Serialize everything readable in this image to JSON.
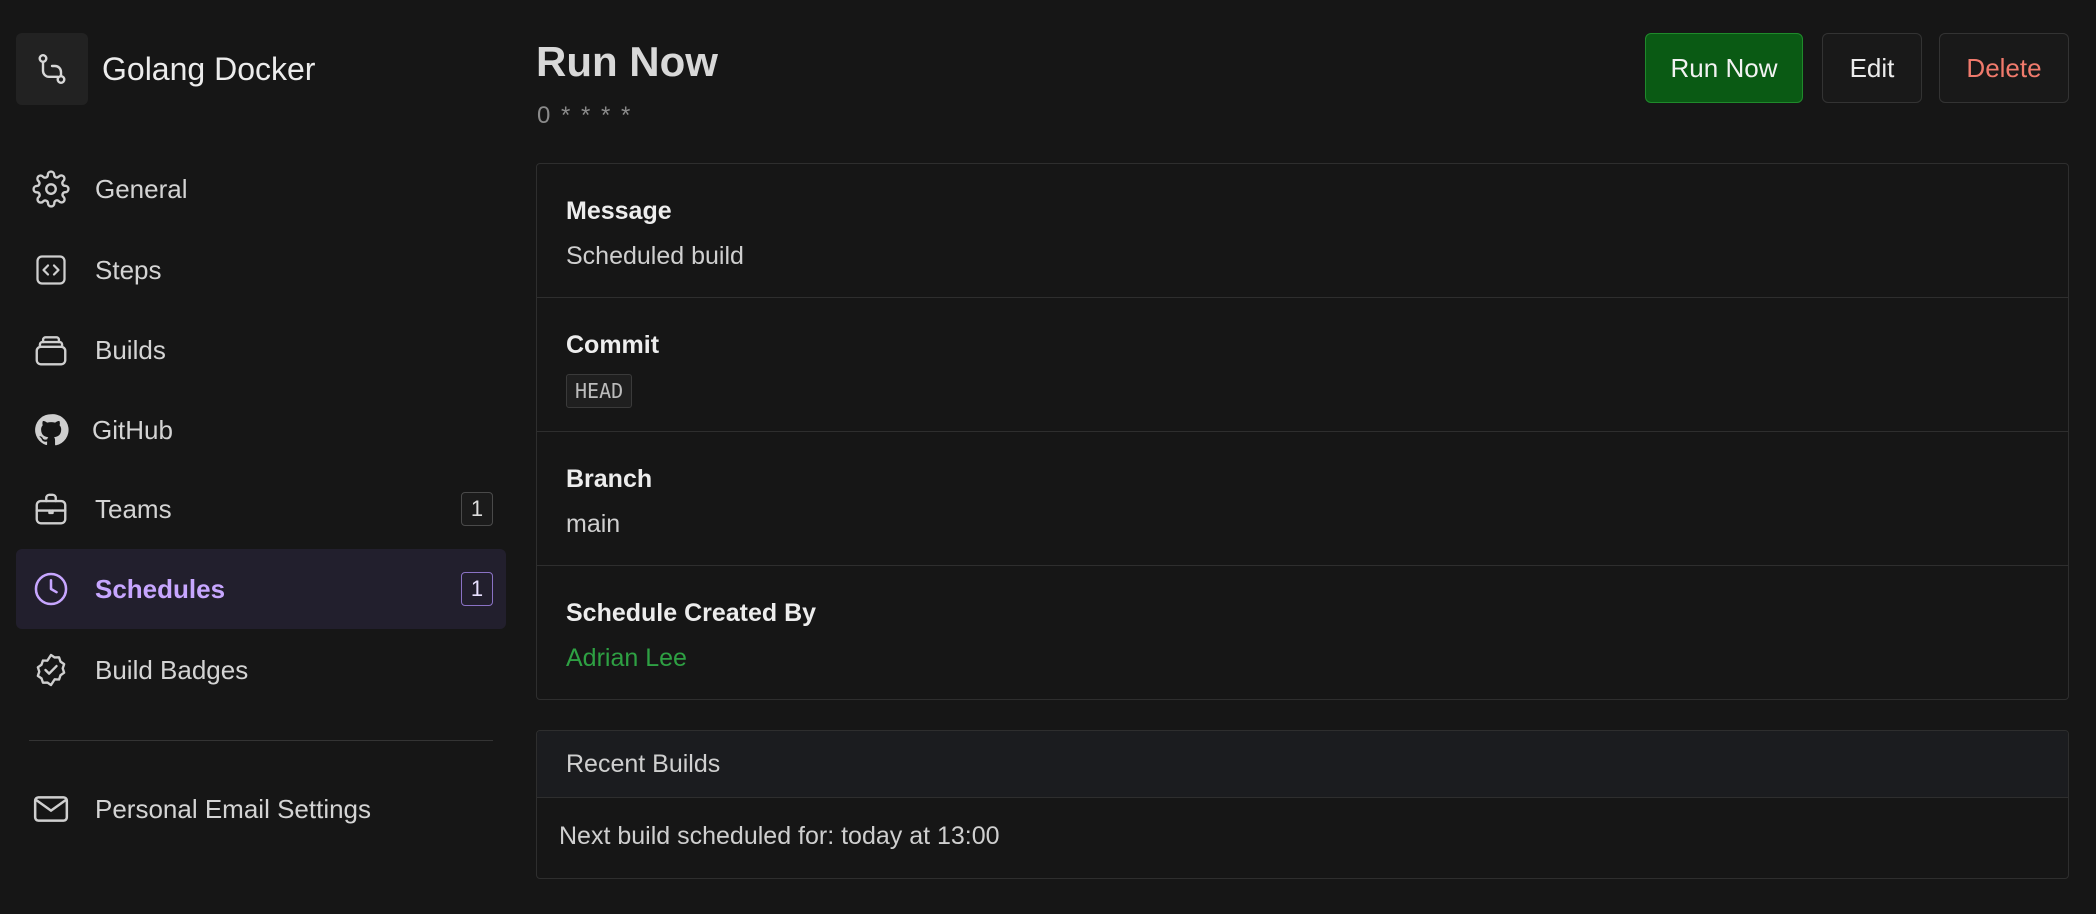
{
  "project": {
    "name": "Golang Docker",
    "icon": "git-branch-icon"
  },
  "sidebar": {
    "items": [
      {
        "label": "General",
        "icon": "gear-icon"
      },
      {
        "label": "Steps",
        "icon": "code-brackets-icon"
      },
      {
        "label": "Builds",
        "icon": "stack-icon"
      },
      {
        "label": "GitHub",
        "icon": "github-icon"
      },
      {
        "label": "Teams",
        "icon": "briefcase-icon",
        "badge": "1"
      },
      {
        "label": "Schedules",
        "icon": "clock-icon",
        "badge": "1",
        "active": true
      },
      {
        "label": "Build Badges",
        "icon": "badge-check-icon"
      }
    ],
    "footer_items": [
      {
        "label": "Personal Email Settings",
        "icon": "mail-icon"
      }
    ]
  },
  "header": {
    "title": "Run Now",
    "cron": "0 * * * *",
    "actions": {
      "run_now": "Run Now",
      "edit": "Edit",
      "delete": "Delete"
    }
  },
  "details": {
    "message": {
      "label": "Message",
      "value": "Scheduled build"
    },
    "commit": {
      "label": "Commit",
      "value": "HEAD"
    },
    "branch": {
      "label": "Branch",
      "value": "main"
    },
    "created_by": {
      "label": "Schedule Created By",
      "value": "Adrian Lee"
    }
  },
  "recent_builds": {
    "title": "Recent Builds",
    "next_build": "Next build scheduled for: today at 13:00"
  },
  "colors": {
    "background": "#161616",
    "active_accent": "#c7a6ff",
    "run_button": "#0a5a14",
    "delete_text": "#f07a6c",
    "link_green": "#2ea043"
  }
}
